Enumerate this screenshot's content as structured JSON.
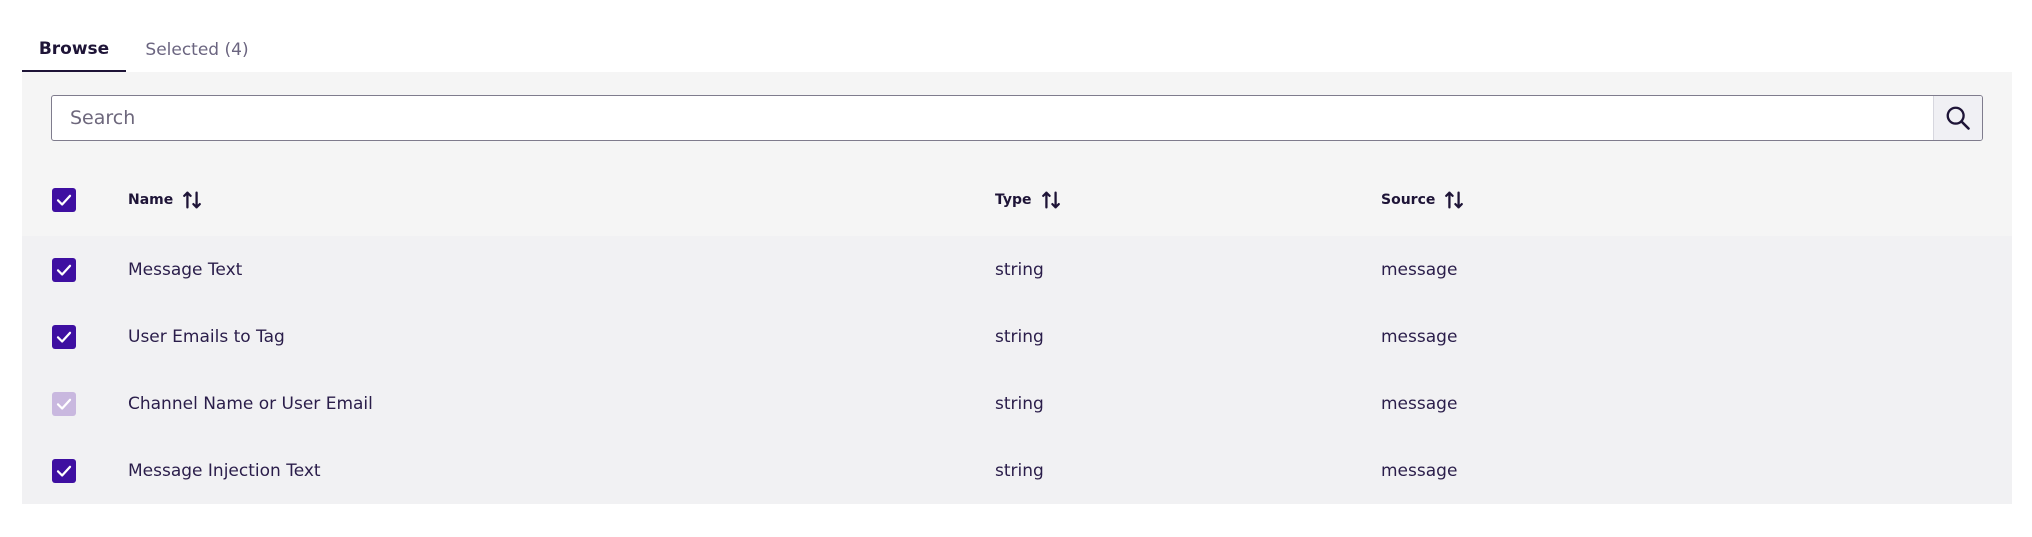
{
  "tabs": [
    {
      "label": "Browse",
      "active": true
    },
    {
      "label": "Selected (4)",
      "active": false
    }
  ],
  "search": {
    "placeholder": "Search",
    "value": "",
    "icon": "search-icon"
  },
  "table": {
    "header": {
      "name": "Name",
      "type": "Type",
      "source": "Source"
    },
    "rows": [
      {
        "name": "Message Text",
        "type": "string",
        "source": "message",
        "checked": true,
        "disabled": false
      },
      {
        "name": "User Emails to Tag",
        "type": "string",
        "source": "message",
        "checked": true,
        "disabled": false
      },
      {
        "name": "Channel Name or User Email",
        "type": "string",
        "source": "message",
        "checked": true,
        "disabled": true
      },
      {
        "name": "Message Injection Text",
        "type": "string",
        "source": "message",
        "checked": true,
        "disabled": false
      }
    ]
  },
  "colors": {
    "accent": "#3e0fa1",
    "accent_disabled": "#c9b8df",
    "text": "#2a1d4a",
    "panel": "#f5f5f5",
    "row": "#f1f1f3"
  },
  "icons": {
    "sort": "sort-icon",
    "checkbox": "checkbox-checked-icon"
  }
}
